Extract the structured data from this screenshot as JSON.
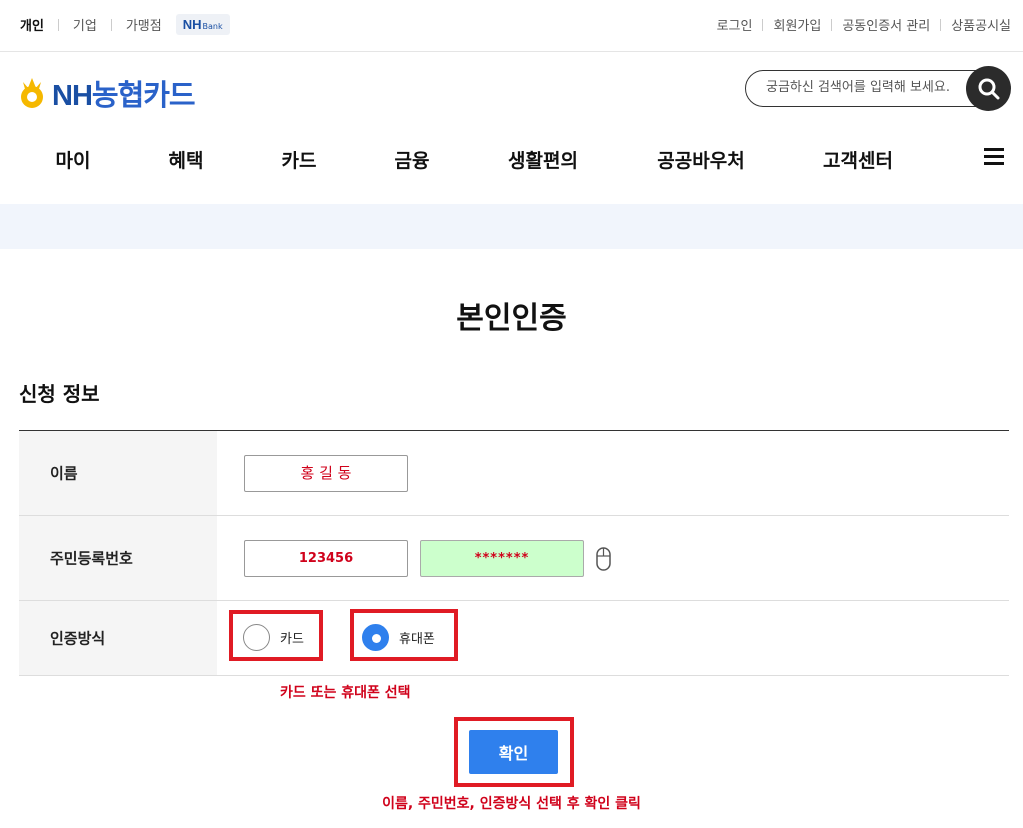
{
  "utility": {
    "left": [
      "개인",
      "기업",
      "가맹점"
    ],
    "nhbank": {
      "nh": "NH",
      "bank": "Bank"
    },
    "right": [
      "로그인",
      "회원가입",
      "공동인증서 관리",
      "상품공시실"
    ]
  },
  "header": {
    "logo_nh": "NH",
    "logo_rest": "농협카드",
    "search_placeholder": "궁금하신 검색어를 입력해 보세요."
  },
  "nav": [
    "마이",
    "혜택",
    "카드",
    "금융",
    "생활편의",
    "공공바우처",
    "고객센터"
  ],
  "page": {
    "title": "본인인증",
    "section_title": "신청 정보"
  },
  "form": {
    "name_label": "이름",
    "name_value": "홍 길 동",
    "jumin_label": "주민등록번호",
    "jumin_front": "123456",
    "jumin_back": "*******",
    "auth_label": "인증방식",
    "auth_options": [
      "카드",
      "휴대폰"
    ],
    "auth_selected": "휴대폰",
    "confirm_label": "확인"
  },
  "annotations": {
    "select_note": "카드 또는 휴대폰 선택",
    "click_note": "이름, 주민번호, 인증방식 선택 후 확인 클릭"
  },
  "colors": {
    "brand": "#1a4fa3",
    "primary_button": "#2f80ed",
    "highlight_red": "#e01b24",
    "jumin_back_bg": "#ccffcc"
  }
}
